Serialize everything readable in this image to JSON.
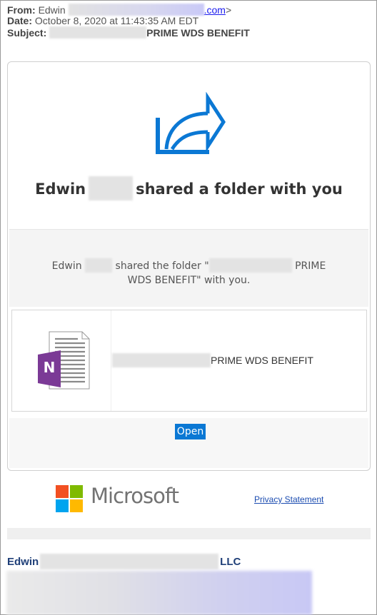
{
  "email": {
    "from_label": "From:",
    "from_name": "Edwin",
    "from_domain": ".com",
    "from_close": ">",
    "date_label": "Date:",
    "date_value": "October 8, 2020 at 11:43:35 AM EDT",
    "subject_label": "Subject:",
    "subject_value": "PRIME WDS BENEFIT"
  },
  "card": {
    "icon": "share-arrow-icon",
    "title_pre": "Edwin",
    "title_post": "shared a folder with you",
    "msg_pre": "Edwin",
    "msg_mid": "shared the folder \"",
    "msg_folder": "PRIME WDS",
    "msg_post": "BENEFIT\" with you.",
    "item_icon": "onenote-icon",
    "item_name": "PRIME WDS BENEFIT",
    "open_label": "Open"
  },
  "footer": {
    "logo_text": "Microsoft",
    "privacy_label": "Privacy Statement"
  },
  "signature": {
    "name_pre": "Edwin",
    "name_post": "LLC"
  },
  "colors": {
    "accent": "#0b78d4",
    "onenote_purple": "#7b3a96",
    "link_blue": "#1a1aee",
    "signature_blue": "#1f3f78"
  }
}
